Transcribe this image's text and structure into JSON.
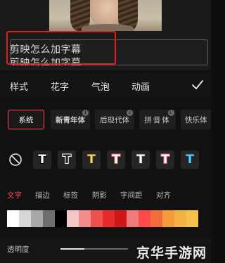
{
  "subtitle": {
    "line1": "剪映怎么加字幕",
    "line2": "剪映怎么加字幕"
  },
  "main_tabs": [
    {
      "label": "样式"
    },
    {
      "label": "花字"
    },
    {
      "label": "气泡"
    },
    {
      "label": "动画"
    }
  ],
  "confirm_icon": "checkmark-icon",
  "fonts": [
    {
      "label": "系统",
      "selected": true
    },
    {
      "label": "新青年体",
      "selected": false
    },
    {
      "label": "后现代体",
      "selected": false
    },
    {
      "label": "拼音体",
      "selected": false
    },
    {
      "label": "快乐体",
      "selected": false
    }
  ],
  "font_download_icon": "↓",
  "presets": {
    "glyph": "T",
    "no_style_icon": "no-style-icon",
    "items": [
      {
        "fill": "#ffffff",
        "stroke": "#000000"
      },
      {
        "fill": "#222222",
        "stroke": "#ffffff"
      },
      {
        "fill": "#f2d36b",
        "stroke": "#3a2f12"
      },
      {
        "fill": "#ffffff",
        "stroke": "#d96565"
      },
      {
        "fill": "#ffffff",
        "stroke": "#3a3a3a"
      },
      {
        "fill": "#ffffff",
        "stroke": "#e0558a"
      },
      {
        "fill": "#5ec8f2",
        "stroke": "#0d3650"
      }
    ]
  },
  "sub_tabs": [
    {
      "label": "文字",
      "active": true
    },
    {
      "label": "描边",
      "active": false
    },
    {
      "label": "标签",
      "active": false
    },
    {
      "label": "阴影",
      "active": false
    },
    {
      "label": "字间距",
      "active": false
    },
    {
      "label": "对齐",
      "active": false
    }
  ],
  "swatches": [
    "#ffffff",
    "#d7d7d7",
    "#a9a9a9",
    "#6e6e6e",
    "#000000",
    "#f5c6c6",
    "#f38d8d",
    "#ee5050",
    "#e52b2b",
    "#d01616",
    "#f07a7a",
    "#ff4a4a",
    "#f26b3c",
    "#f59a3a",
    "#f5b340",
    "#f6c24d"
  ],
  "opacity": {
    "label": "透明度",
    "value": 0.35
  },
  "watermark": "京华手游网"
}
